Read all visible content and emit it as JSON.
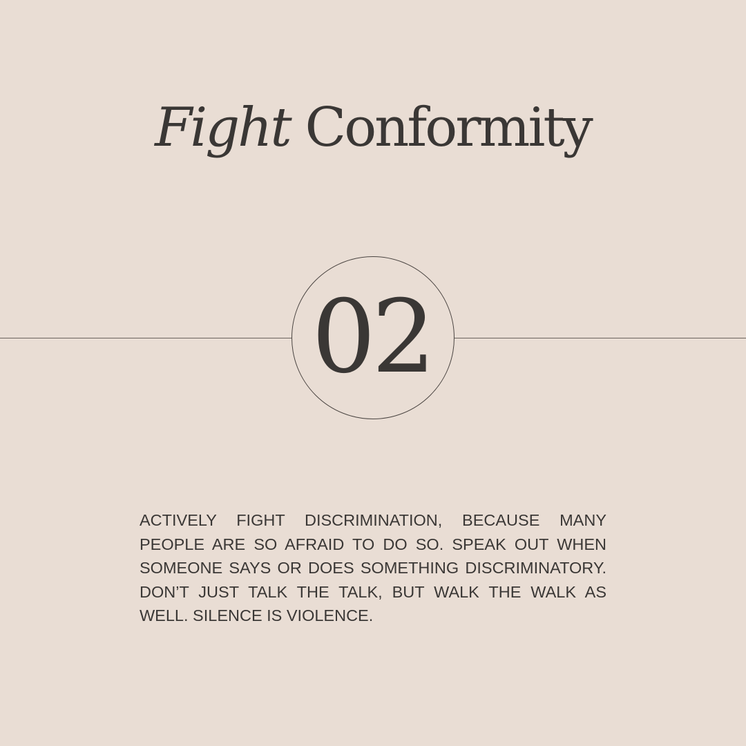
{
  "title": {
    "italic_part": "Fight",
    "regular_part": "Conformity"
  },
  "badge": {
    "number": "02"
  },
  "body": {
    "text": "ACTIVELY FIGHT DISCRIMINATION, BECAUSE MANY PEOPLE ARE SO AFRAID TO DO SO. SPEAK OUT WHEN SOMEONE SAYS OR DOES SOMETHING DISCRIMINATORY. DON’T JUST TALK THE TALK, BUT WALK THE WALK AS WELL. SILENCE IS VIOLENCE."
  },
  "colors": {
    "background": "#e9ddd4",
    "text": "#3a3735",
    "line": "#6b625d"
  }
}
